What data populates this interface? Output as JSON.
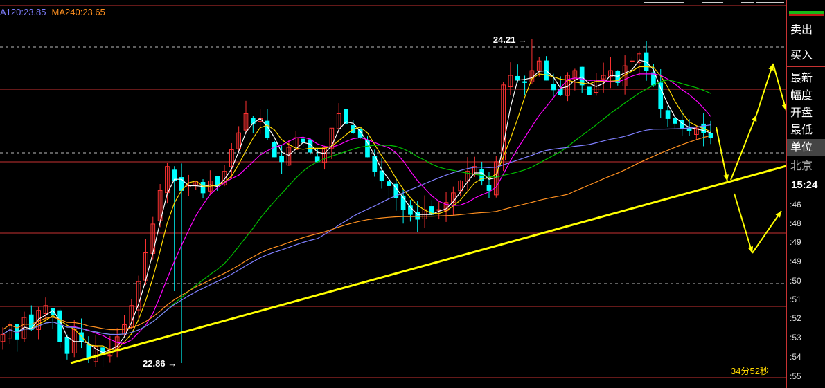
{
  "legend": {
    "ma120": "A120:23.85",
    "ma240": "MA240:23.65",
    "ma120_color": "#7f7fff",
    "ma240_color": "#ff9020"
  },
  "annotations": {
    "high_label": "24.21",
    "low_label": "22.86",
    "timer": "34分52秒"
  },
  "side_panel": {
    "items": [
      {
        "label": "卖出",
        "boxed": true
      },
      {
        "label": "买入",
        "boxed": true
      },
      {
        "label": "最新"
      },
      {
        "label": "幅度"
      },
      {
        "label": "开盘"
      },
      {
        "label": "最低",
        "boxed": true
      },
      {
        "label": "单位",
        "selected": true
      },
      {
        "label": "北京",
        "dim": true
      }
    ],
    "clock": "15:24",
    "ticks": [
      ":46",
      ":48",
      ":49",
      ":49",
      ":50",
      ":51",
      ":52",
      ":53",
      ":54",
      ":55"
    ]
  },
  "colors": {
    "bull": "#ff3232",
    "bear": "#00ffff",
    "ma_short": "#ffffff",
    "ma_mid": "#ffd800",
    "ma_long": "#ff00ff",
    "ma_green": "#00c000",
    "trendline": "#ffff00",
    "grid": "#c83232",
    "dashed": "#bbbbbb"
  },
  "chart_data": {
    "type": "candlestick",
    "ylim": [
      22.8,
      24.5
    ],
    "y_high_marker": 24.21,
    "y_low_marker": 22.86,
    "close_series": [
      22.98,
      23.02,
      22.96,
      23.05,
      23.0,
      23.08,
      23.1,
      23.06,
      22.95,
      22.9,
      23.0,
      22.95,
      22.88,
      22.93,
      22.9,
      22.92,
      22.97,
      23.02,
      23.1,
      23.2,
      23.32,
      23.44,
      23.58,
      23.68,
      23.62,
      23.58,
      23.6,
      23.62,
      23.57,
      23.62,
      23.6,
      23.66,
      23.75,
      23.82,
      23.9,
      23.86,
      23.88,
      23.8,
      23.72,
      23.7,
      23.76,
      23.8,
      23.78,
      23.74,
      23.7,
      23.76,
      23.84,
      23.9,
      23.86,
      23.82,
      23.8,
      23.72,
      23.66,
      23.62,
      23.6,
      23.55,
      23.5,
      23.48,
      23.46,
      23.5,
      23.48,
      23.5,
      23.53,
      23.57,
      23.62,
      23.66,
      23.68,
      23.62,
      23.58,
      23.7,
      24.02,
      24.06,
      24.04,
      24.03,
      24.08,
      24.12,
      24.04,
      24.0,
      23.98,
      24.06,
      24.08,
      24.02,
      23.98,
      24.04,
      24.06,
      24.08,
      24.03,
      24.1,
      24.12,
      24.15,
      24.08,
      24.02,
      23.92,
      23.88,
      23.86,
      23.84,
      23.83,
      23.84,
      23.82,
      23.8
    ]
  }
}
